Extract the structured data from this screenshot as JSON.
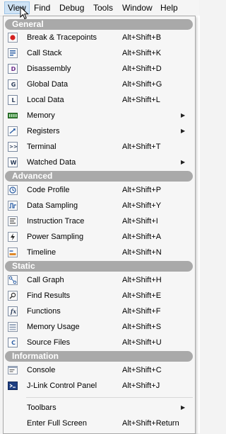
{
  "menubar": {
    "items": [
      "View",
      "Find",
      "Debug",
      "Tools",
      "Window",
      "Help"
    ]
  },
  "menu": {
    "sections": {
      "general": "General",
      "advanced": "Advanced",
      "static": "Static",
      "information": "Information"
    },
    "items": [
      {
        "label": "Break & Tracepoints",
        "shortcut": "Alt+Shift+B",
        "icon": "breakpoint-icon"
      },
      {
        "label": "Call Stack",
        "shortcut": "Alt+Shift+K",
        "icon": "call-stack-icon"
      },
      {
        "label": "Disassembly",
        "shortcut": "Alt+Shift+D",
        "icon": "disassembly-icon"
      },
      {
        "label": "Global Data",
        "shortcut": "Alt+Shift+G",
        "icon": "global-data-icon"
      },
      {
        "label": "Local Data",
        "shortcut": "Alt+Shift+L",
        "icon": "local-data-icon"
      },
      {
        "label": "Memory",
        "shortcut": "",
        "icon": "memory-icon",
        "submenu": true
      },
      {
        "label": "Registers",
        "shortcut": "",
        "icon": "registers-icon",
        "submenu": true
      },
      {
        "label": "Terminal",
        "shortcut": "Alt+Shift+T",
        "icon": "terminal-icon"
      },
      {
        "label": "Watched Data",
        "shortcut": "",
        "icon": "watched-data-icon",
        "submenu": true
      },
      {
        "label": "Code Profile",
        "shortcut": "Alt+Shift+P",
        "icon": "code-profile-icon"
      },
      {
        "label": "Data Sampling",
        "shortcut": "Alt+Shift+Y",
        "icon": "data-sampling-icon"
      },
      {
        "label": "Instruction Trace",
        "shortcut": "Alt+Shift+I",
        "icon": "instruction-trace-icon"
      },
      {
        "label": "Power Sampling",
        "shortcut": "Alt+Shift+A",
        "icon": "power-sampling-icon"
      },
      {
        "label": "Timeline",
        "shortcut": "Alt+Shift+N",
        "icon": "timeline-icon"
      },
      {
        "label": "Call Graph",
        "shortcut": "Alt+Shift+H",
        "icon": "call-graph-icon"
      },
      {
        "label": "Find Results",
        "shortcut": "Alt+Shift+E",
        "icon": "find-results-icon"
      },
      {
        "label": "Functions",
        "shortcut": "Alt+Shift+F",
        "icon": "functions-icon"
      },
      {
        "label": "Memory Usage",
        "shortcut": "Alt+Shift+S",
        "icon": "memory-usage-icon"
      },
      {
        "label": "Source Files",
        "shortcut": "Alt+Shift+U",
        "icon": "source-files-icon"
      },
      {
        "label": "Console",
        "shortcut": "Alt+Shift+C",
        "icon": "console-icon"
      },
      {
        "label": "J-Link Control Panel",
        "shortcut": "Alt+Shift+J",
        "icon": "jlink-icon"
      },
      {
        "label": "Toolbars",
        "shortcut": "",
        "submenu": true
      },
      {
        "label": "Enter Full Screen",
        "shortcut": "Alt+Shift+Return"
      }
    ]
  },
  "icon_glyphs": {
    "disassembly": "D",
    "global_data": "G",
    "local_data": "L",
    "terminal": ">>",
    "watched_data": "W",
    "functions": "fx",
    "source_files": "C"
  },
  "colors": {
    "menu_bg": "#f6f6f6",
    "section_header": "#a9a9a9",
    "active_menu": "#cfe3f5",
    "icon_blue": "#2b5fa6",
    "icon_red": "#d42020"
  }
}
